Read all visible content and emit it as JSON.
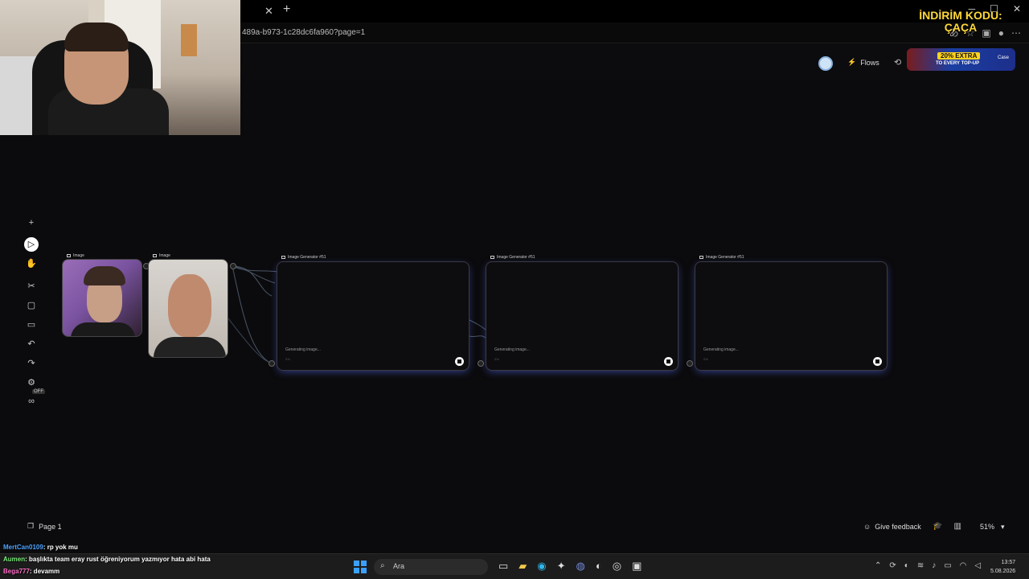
{
  "browser": {
    "url": "489a-b973-1c28dc6fa960?page=1",
    "close_tab_symbol": "✕",
    "new_tab_symbol": "+"
  },
  "promo": {
    "line1": "İNDİRİM KODU:",
    "line2": "ÇAÇA",
    "banner_tag": "20% EXTRA",
    "banner_sub": "TO EVERY TOP-UP",
    "banner_brand": "Case"
  },
  "header": {
    "flows_label": "Flows"
  },
  "nodes": {
    "image1_label": "Image",
    "image2_label": "Image",
    "generators": [
      {
        "title": "Image Generator #51",
        "status": "Generating image...",
        "percent": "0%"
      },
      {
        "title": "Image Generator #51",
        "status": "Generating image...",
        "percent": "0%"
      },
      {
        "title": "Image Generator #51",
        "status": "Generating image...",
        "percent": "0%"
      }
    ]
  },
  "toolbar": {
    "off_badge": "OFF"
  },
  "footer": {
    "page_label": "Page 1",
    "feedback_label": "Give feedback",
    "zoom_label": "51%"
  },
  "chat": [
    {
      "user": "MertCan0109",
      "message": ": rp yok mu"
    },
    {
      "user": "Aumen",
      "message": ": başlıkta team eray rust öğreniyorum yazmıyor hata abi hata"
    },
    {
      "user": "Bega777",
      "message": ": devamm"
    }
  ],
  "taskbar": {
    "search_placeholder": "Ara",
    "time": "13:57",
    "date": "5.08.2026"
  },
  "colors": {
    "accent_glow": "#5a6eff",
    "promo_yellow": "#ffd83a"
  }
}
